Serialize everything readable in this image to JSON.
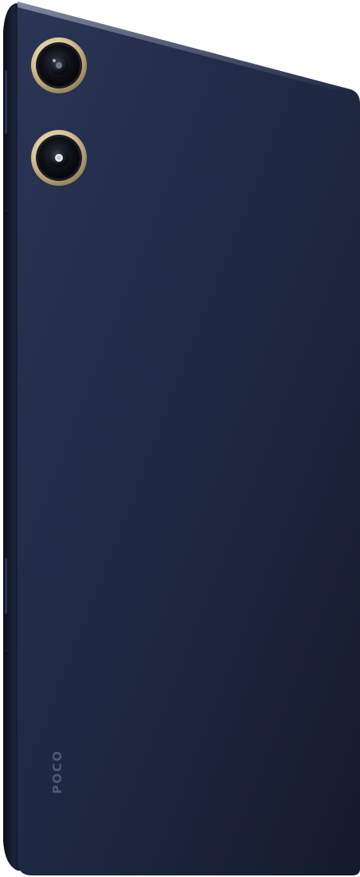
{
  "product": {
    "brand_logo": "POCO",
    "color_body": "#1f2a45",
    "color_edge": "#0c111d",
    "color_ring": "#d8c59a"
  },
  "camera_module": {
    "lenses": [
      {
        "name": "main-camera-lens"
      },
      {
        "name": "secondary-camera-lens"
      }
    ]
  }
}
